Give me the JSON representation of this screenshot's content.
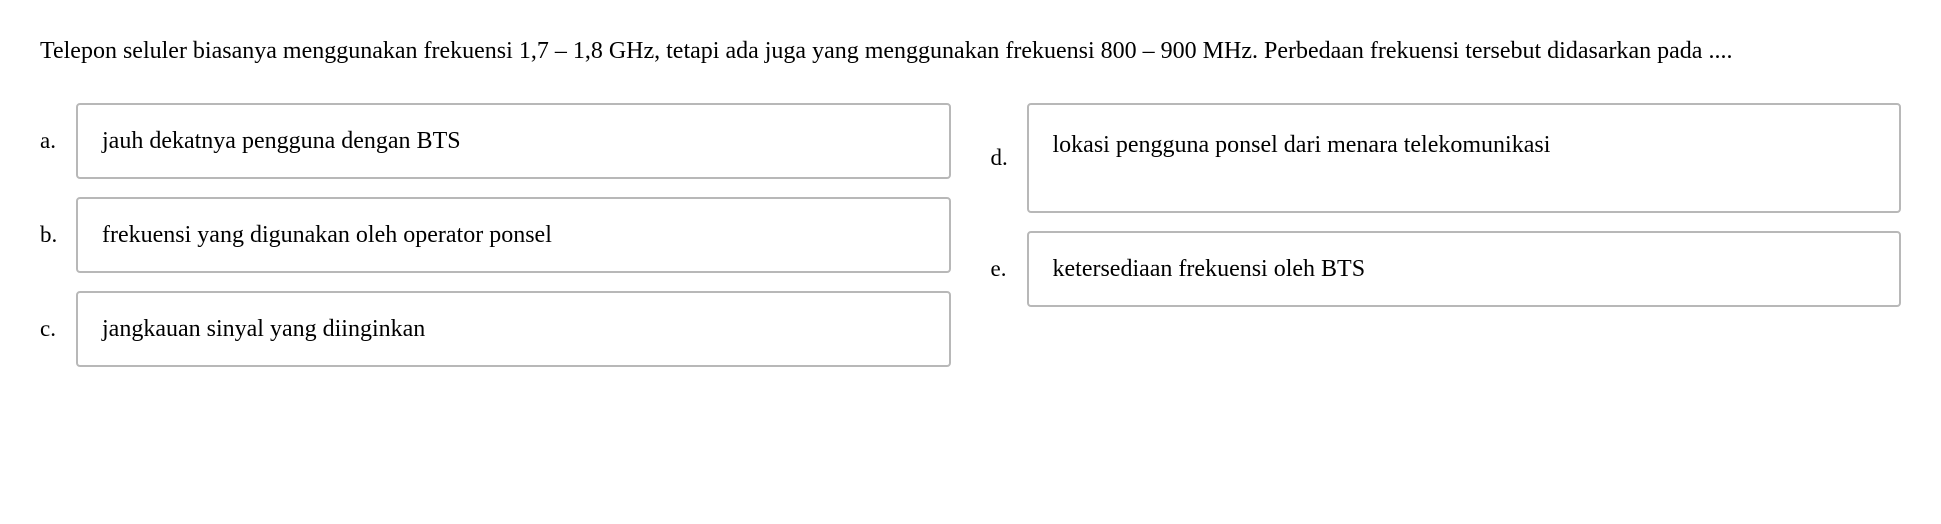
{
  "question": {
    "text": "Telepon seluler biasanya menggunakan frekuensi 1,7 – 1,8  GHz, tetapi ada juga yang menggunakan frekuensi 800 – 900 MHz. Perbedaan frekuensi tersebut didasarkan pada ...."
  },
  "options": {
    "a": {
      "label": "a.",
      "text": "jauh dekatnya pengguna dengan BTS"
    },
    "b": {
      "label": "b.",
      "text": "frekuensi yang digunakan oleh operator ponsel"
    },
    "c": {
      "label": "c.",
      "text": "jangkauan sinyal yang diinginkan"
    },
    "d": {
      "label": "d.",
      "text": "lokasi pengguna ponsel dari menara telekomunikasi"
    },
    "e": {
      "label": "e.",
      "text": "ketersediaan frekuensi oleh BTS"
    }
  }
}
